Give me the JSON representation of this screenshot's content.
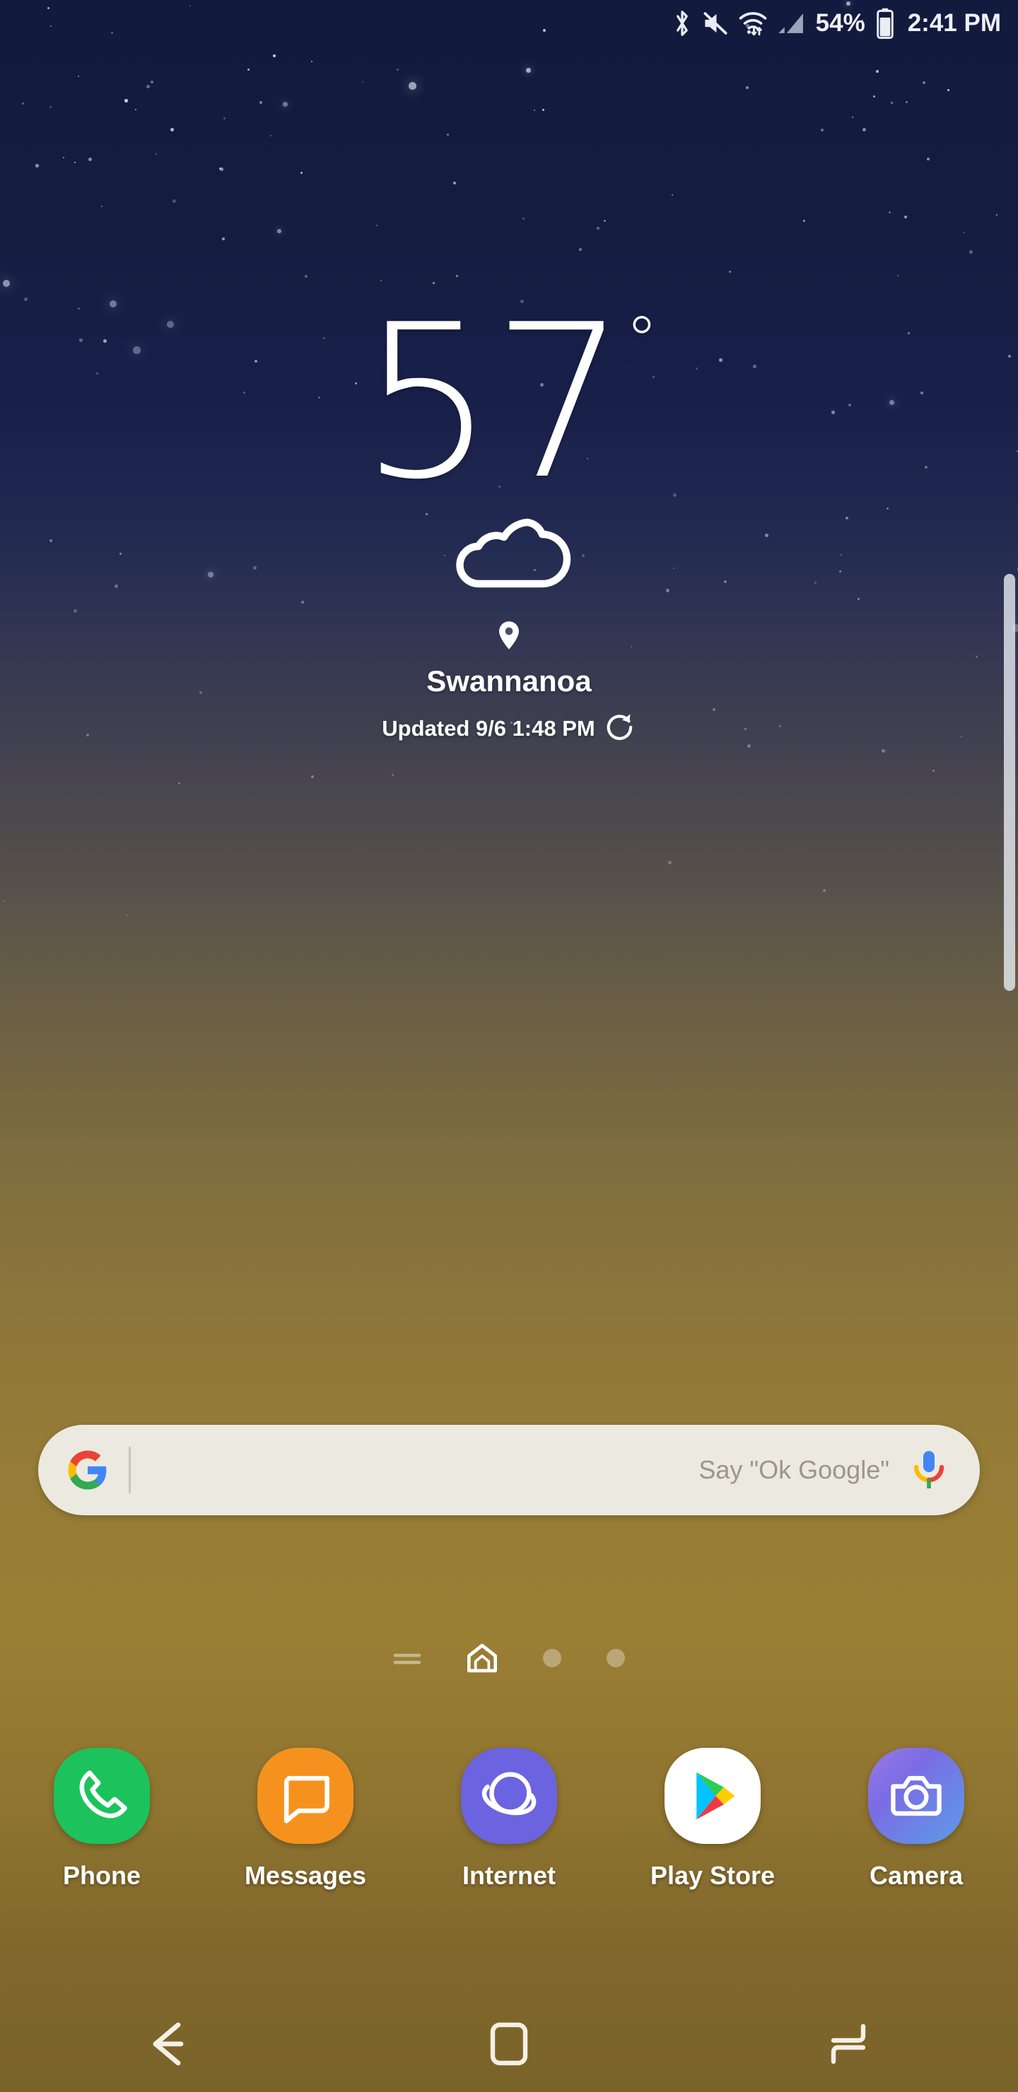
{
  "status_bar": {
    "icons": [
      {
        "name": "bluetooth-icon",
        "label": "Bluetooth"
      },
      {
        "name": "mute-icon",
        "label": "Sound off"
      },
      {
        "name": "wifi-icon",
        "label": "Wi-Fi"
      },
      {
        "name": "signal-icon",
        "label": "Mobile signal"
      }
    ],
    "battery_percent": "54%",
    "battery_icon": "battery-icon",
    "clock": "2:41 PM"
  },
  "weather_widget": {
    "temperature": "57",
    "degree_symbol": "°",
    "condition_icon": "cloudy-icon",
    "location_icon": "location-pin-icon",
    "location": "Swannanoa",
    "updated_text": "Updated 9/6 1:48 PM",
    "refresh_icon": "refresh-icon"
  },
  "search": {
    "logo_icon": "google-g-icon",
    "placeholder": "Say \"Ok Google\"",
    "value": "",
    "mic_icon": "google-mic-icon"
  },
  "page_indicator": {
    "items": [
      {
        "name": "page-indicator-feed",
        "type": "lines",
        "active": false
      },
      {
        "name": "page-indicator-home",
        "type": "home",
        "active": true
      },
      {
        "name": "page-indicator-dot-1",
        "type": "dot",
        "active": false
      },
      {
        "name": "page-indicator-dot-2",
        "type": "dot",
        "active": false
      }
    ]
  },
  "dock": {
    "apps": [
      {
        "label": "Phone",
        "icon": "phone-icon",
        "color": "#1cc35c"
      },
      {
        "label": "Messages",
        "icon": "messages-icon",
        "color": "#f5921e"
      },
      {
        "label": "Internet",
        "icon": "internet-icon",
        "color": "#6c63e0"
      },
      {
        "label": "Play Store",
        "icon": "play-store-icon",
        "color": "#ffffff"
      },
      {
        "label": "Camera",
        "icon": "camera-icon",
        "color": "#7b6ce4"
      }
    ]
  },
  "navigation_bar": {
    "buttons": [
      {
        "name": "back-button",
        "label": "Back"
      },
      {
        "name": "home-button",
        "label": "Home"
      },
      {
        "name": "recents-button",
        "label": "Recents"
      }
    ]
  },
  "colors": {
    "sky_top": "#121a3d",
    "ground_bottom": "#7a6329",
    "search_bg": "#ece9e1",
    "accent_text": "#ffffff"
  }
}
